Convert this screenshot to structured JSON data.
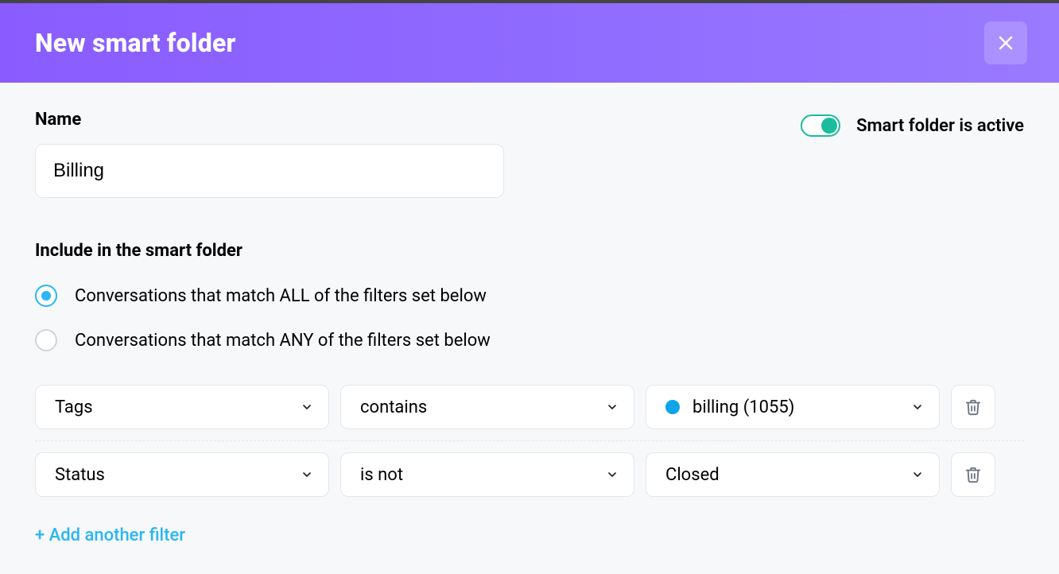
{
  "header": {
    "title": "New smart folder"
  },
  "name": {
    "label": "Name",
    "value": "Billing"
  },
  "toggle": {
    "label": "Smart folder is active",
    "on": true
  },
  "include": {
    "label": "Include in the smart folder",
    "options": [
      {
        "label": "Conversations that match ALL of the filters set below",
        "selected": true
      },
      {
        "label": "Conversations that match ANY of the filters set below",
        "selected": false
      }
    ]
  },
  "filters": [
    {
      "field": "Tags",
      "operator": "contains",
      "value": "billing (1055)",
      "has_dot": true,
      "dot_color": "#0ea5e9"
    },
    {
      "field": "Status",
      "operator": "is not",
      "value": "Closed",
      "has_dot": false
    }
  ],
  "add_filter_label": "+ Add another filter"
}
